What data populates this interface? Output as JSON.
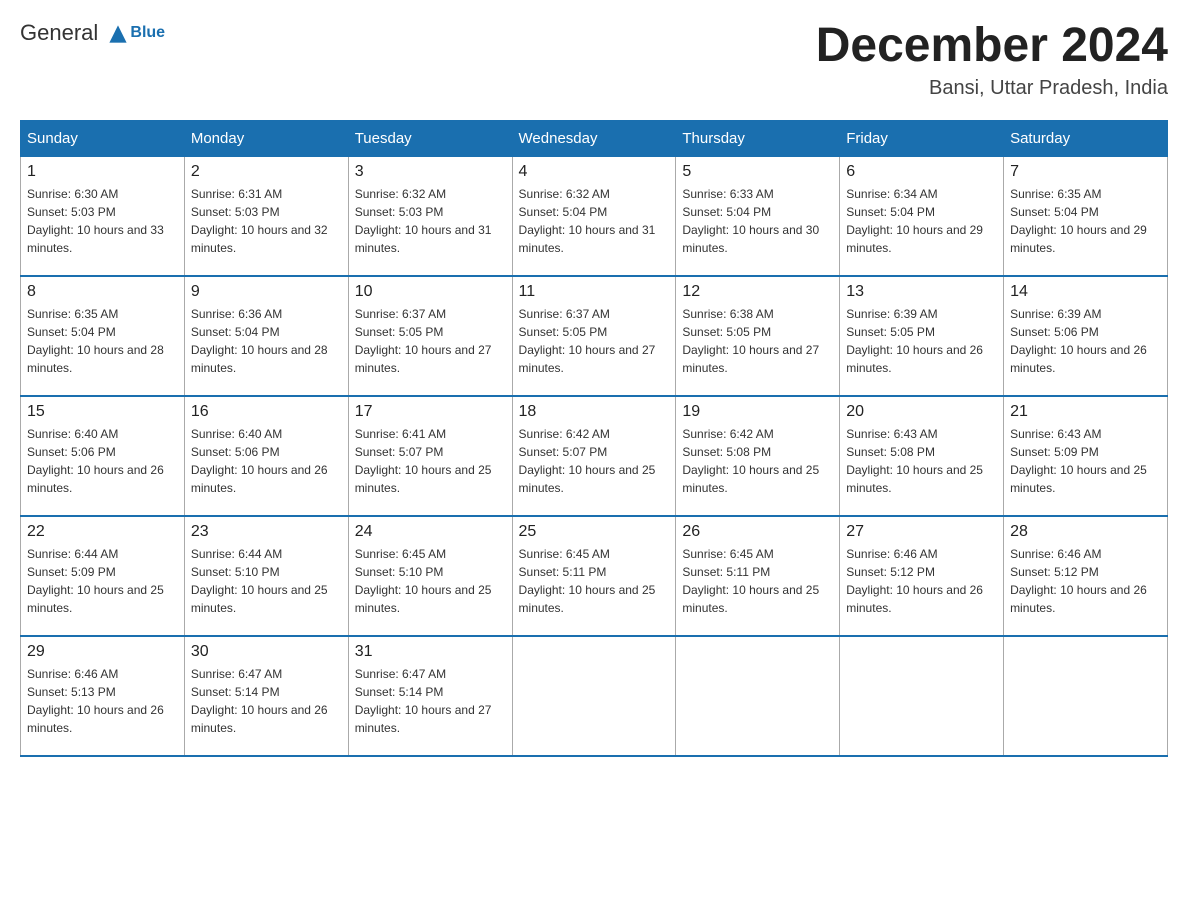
{
  "logo": {
    "text_general": "General",
    "text_blue": "Blue"
  },
  "title": "December 2024",
  "subtitle": "Bansi, Uttar Pradesh, India",
  "days_of_week": [
    "Sunday",
    "Monday",
    "Tuesday",
    "Wednesday",
    "Thursday",
    "Friday",
    "Saturday"
  ],
  "weeks": [
    [
      {
        "day": "1",
        "sunrise": "6:30 AM",
        "sunset": "5:03 PM",
        "daylight": "10 hours and 33 minutes."
      },
      {
        "day": "2",
        "sunrise": "6:31 AM",
        "sunset": "5:03 PM",
        "daylight": "10 hours and 32 minutes."
      },
      {
        "day": "3",
        "sunrise": "6:32 AM",
        "sunset": "5:03 PM",
        "daylight": "10 hours and 31 minutes."
      },
      {
        "day": "4",
        "sunrise": "6:32 AM",
        "sunset": "5:04 PM",
        "daylight": "10 hours and 31 minutes."
      },
      {
        "day": "5",
        "sunrise": "6:33 AM",
        "sunset": "5:04 PM",
        "daylight": "10 hours and 30 minutes."
      },
      {
        "day": "6",
        "sunrise": "6:34 AM",
        "sunset": "5:04 PM",
        "daylight": "10 hours and 29 minutes."
      },
      {
        "day": "7",
        "sunrise": "6:35 AM",
        "sunset": "5:04 PM",
        "daylight": "10 hours and 29 minutes."
      }
    ],
    [
      {
        "day": "8",
        "sunrise": "6:35 AM",
        "sunset": "5:04 PM",
        "daylight": "10 hours and 28 minutes."
      },
      {
        "day": "9",
        "sunrise": "6:36 AM",
        "sunset": "5:04 PM",
        "daylight": "10 hours and 28 minutes."
      },
      {
        "day": "10",
        "sunrise": "6:37 AM",
        "sunset": "5:05 PM",
        "daylight": "10 hours and 27 minutes."
      },
      {
        "day": "11",
        "sunrise": "6:37 AM",
        "sunset": "5:05 PM",
        "daylight": "10 hours and 27 minutes."
      },
      {
        "day": "12",
        "sunrise": "6:38 AM",
        "sunset": "5:05 PM",
        "daylight": "10 hours and 27 minutes."
      },
      {
        "day": "13",
        "sunrise": "6:39 AM",
        "sunset": "5:05 PM",
        "daylight": "10 hours and 26 minutes."
      },
      {
        "day": "14",
        "sunrise": "6:39 AM",
        "sunset": "5:06 PM",
        "daylight": "10 hours and 26 minutes."
      }
    ],
    [
      {
        "day": "15",
        "sunrise": "6:40 AM",
        "sunset": "5:06 PM",
        "daylight": "10 hours and 26 minutes."
      },
      {
        "day": "16",
        "sunrise": "6:40 AM",
        "sunset": "5:06 PM",
        "daylight": "10 hours and 26 minutes."
      },
      {
        "day": "17",
        "sunrise": "6:41 AM",
        "sunset": "5:07 PM",
        "daylight": "10 hours and 25 minutes."
      },
      {
        "day": "18",
        "sunrise": "6:42 AM",
        "sunset": "5:07 PM",
        "daylight": "10 hours and 25 minutes."
      },
      {
        "day": "19",
        "sunrise": "6:42 AM",
        "sunset": "5:08 PM",
        "daylight": "10 hours and 25 minutes."
      },
      {
        "day": "20",
        "sunrise": "6:43 AM",
        "sunset": "5:08 PM",
        "daylight": "10 hours and 25 minutes."
      },
      {
        "day": "21",
        "sunrise": "6:43 AM",
        "sunset": "5:09 PM",
        "daylight": "10 hours and 25 minutes."
      }
    ],
    [
      {
        "day": "22",
        "sunrise": "6:44 AM",
        "sunset": "5:09 PM",
        "daylight": "10 hours and 25 minutes."
      },
      {
        "day": "23",
        "sunrise": "6:44 AM",
        "sunset": "5:10 PM",
        "daylight": "10 hours and 25 minutes."
      },
      {
        "day": "24",
        "sunrise": "6:45 AM",
        "sunset": "5:10 PM",
        "daylight": "10 hours and 25 minutes."
      },
      {
        "day": "25",
        "sunrise": "6:45 AM",
        "sunset": "5:11 PM",
        "daylight": "10 hours and 25 minutes."
      },
      {
        "day": "26",
        "sunrise": "6:45 AM",
        "sunset": "5:11 PM",
        "daylight": "10 hours and 25 minutes."
      },
      {
        "day": "27",
        "sunrise": "6:46 AM",
        "sunset": "5:12 PM",
        "daylight": "10 hours and 26 minutes."
      },
      {
        "day": "28",
        "sunrise": "6:46 AM",
        "sunset": "5:12 PM",
        "daylight": "10 hours and 26 minutes."
      }
    ],
    [
      {
        "day": "29",
        "sunrise": "6:46 AM",
        "sunset": "5:13 PM",
        "daylight": "10 hours and 26 minutes."
      },
      {
        "day": "30",
        "sunrise": "6:47 AM",
        "sunset": "5:14 PM",
        "daylight": "10 hours and 26 minutes."
      },
      {
        "day": "31",
        "sunrise": "6:47 AM",
        "sunset": "5:14 PM",
        "daylight": "10 hours and 27 minutes."
      },
      null,
      null,
      null,
      null
    ]
  ]
}
